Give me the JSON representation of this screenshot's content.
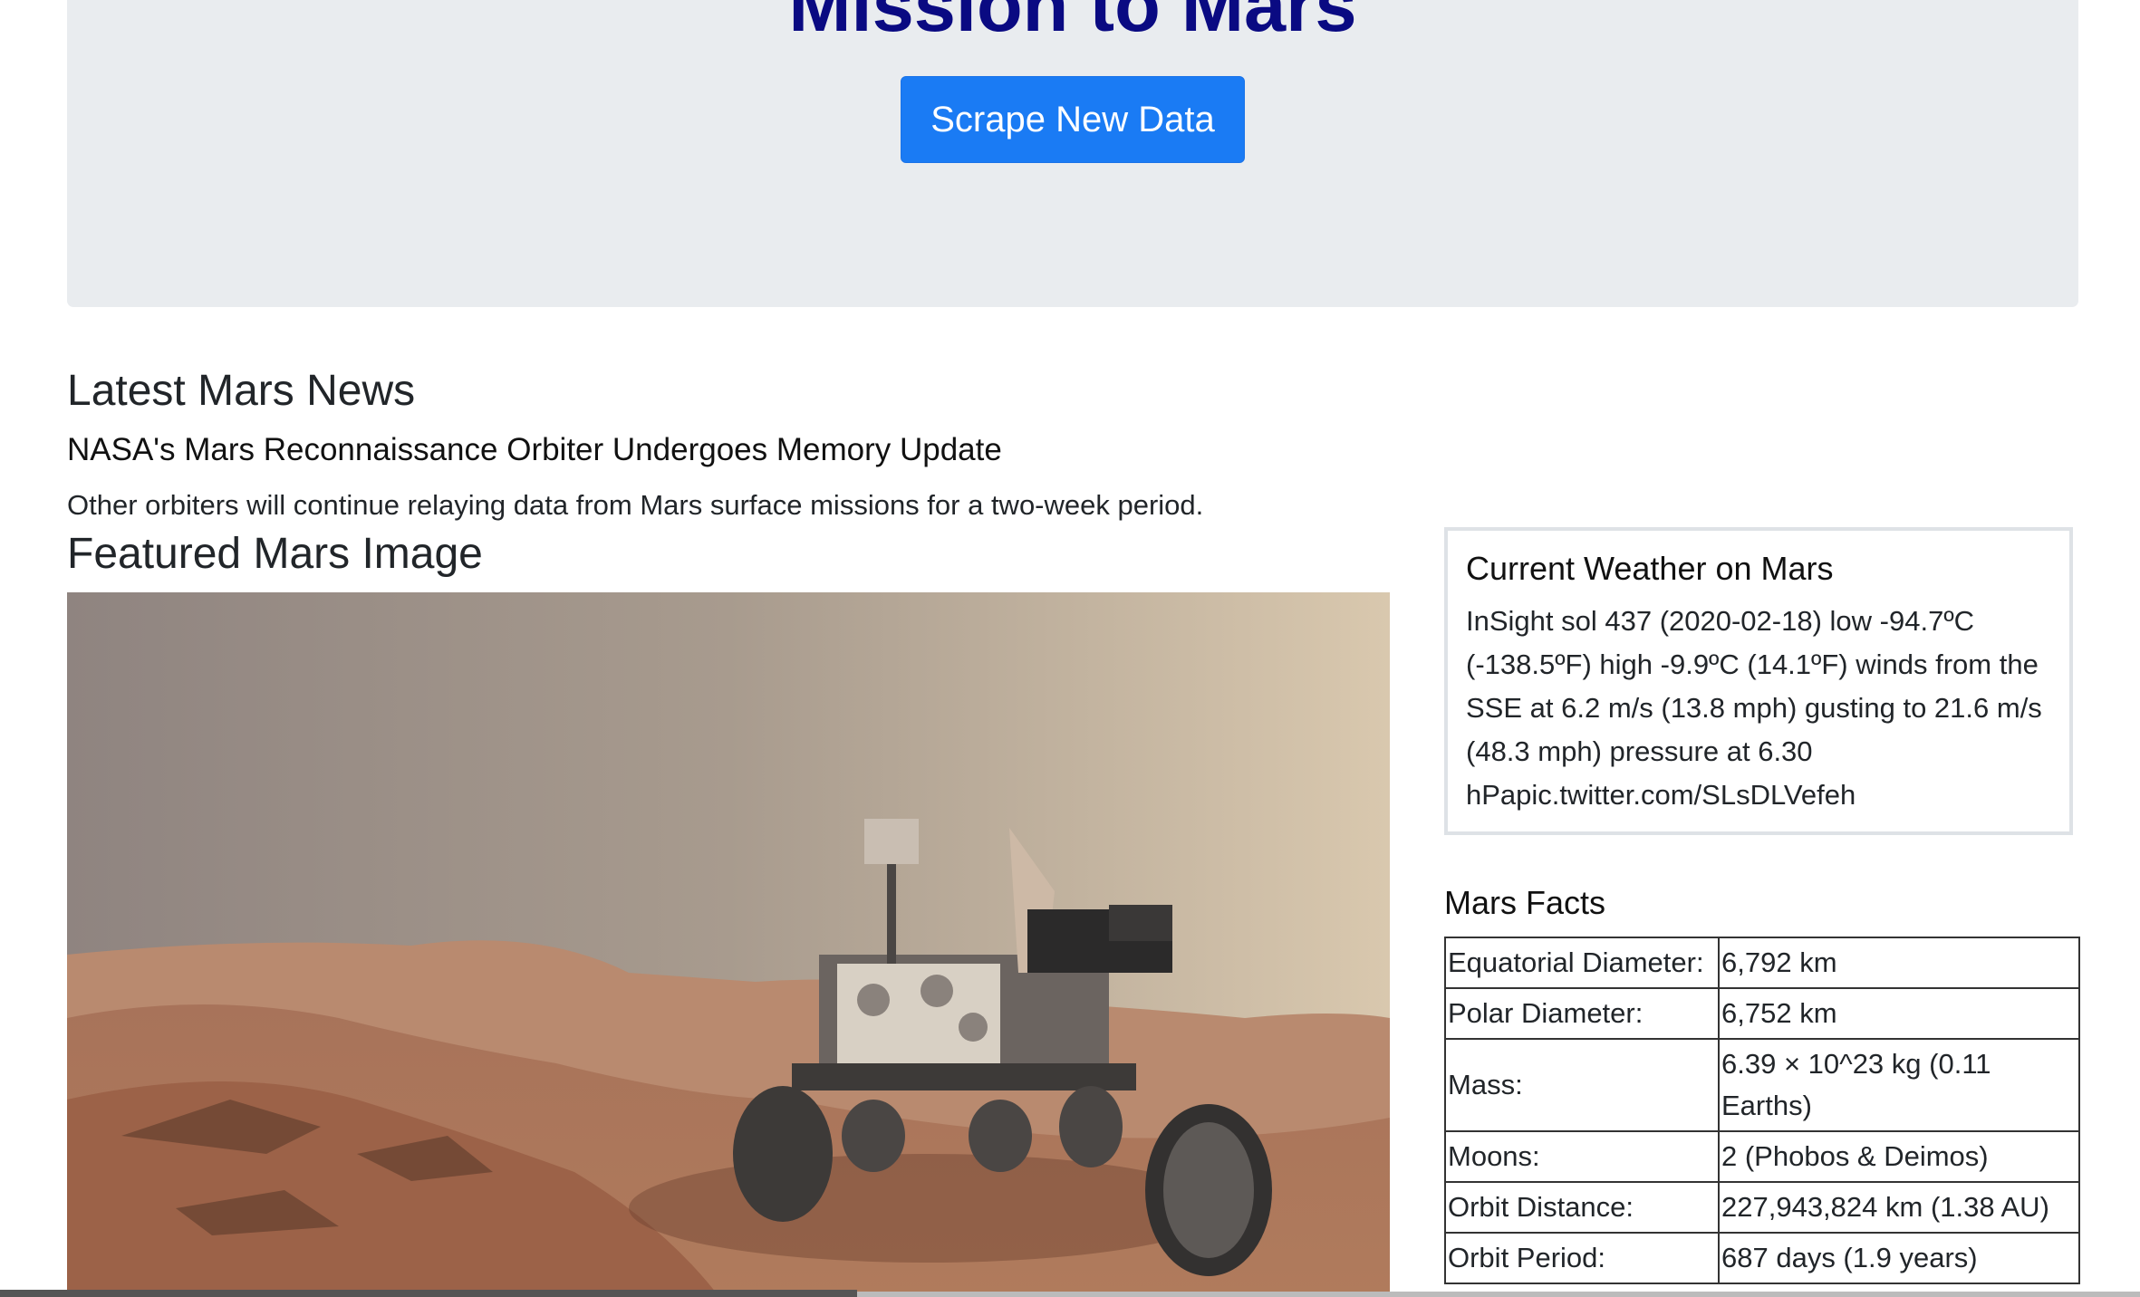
{
  "header": {
    "title": "Mission to Mars",
    "scrape_button_label": "Scrape New Data"
  },
  "news": {
    "heading": "Latest Mars News",
    "title": "NASA's Mars Reconnaissance Orbiter Undergoes Memory Update",
    "teaser": "Other orbiters will continue relaying data from Mars surface missions for a two-week period."
  },
  "featured_image": {
    "heading": "Featured Mars Image"
  },
  "weather": {
    "heading": "Current Weather on Mars",
    "text": "InSight sol 437 (2020-02-18) low -94.7ºC (-138.5ºF) high -9.9ºC (14.1ºF) winds from the SSE at 6.2 m/s (13.8 mph) gusting to 21.6 m/s (48.3 mph) pressure at 6.30 hPapic.twitter.com/SLsDLVefeh"
  },
  "facts": {
    "heading": "Mars Facts",
    "rows": [
      {
        "label": "Equatorial Diameter:",
        "value": "6,792 km"
      },
      {
        "label": "Polar Diameter:",
        "value": "6,752 km"
      },
      {
        "label": "Mass:",
        "value": "6.39 × 10^23 kg (0.11 Earths)"
      },
      {
        "label": "Moons:",
        "value": "2 (Phobos & Deimos)"
      },
      {
        "label": "Orbit Distance:",
        "value": "227,943,824 km (1.38 AU)"
      },
      {
        "label": "Orbit Period:",
        "value": "687 days (1.9 years)"
      }
    ]
  },
  "colors": {
    "title": "#0a0a82",
    "button": "#1a7bf4",
    "jumbotron": "#e9ecef"
  }
}
